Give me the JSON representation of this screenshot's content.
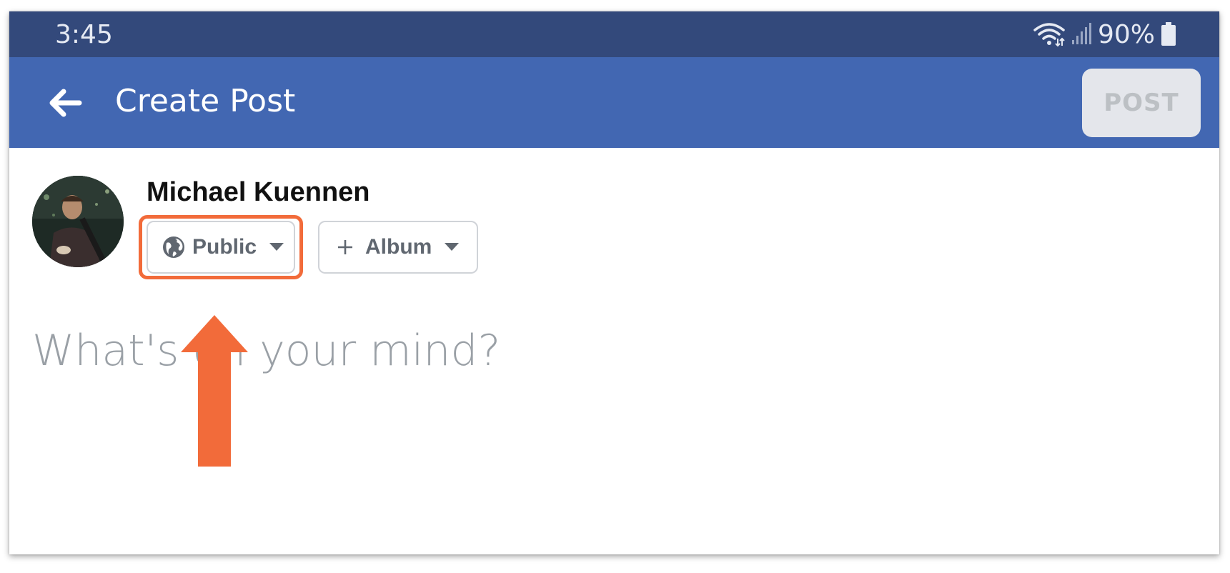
{
  "status_bar": {
    "time": "3:45",
    "battery": "90%",
    "icons": [
      "wifi-icon",
      "signal-icon",
      "battery-icon"
    ]
  },
  "app_bar": {
    "back_icon": "back-arrow-icon",
    "title": "Create Post",
    "post_label": "POST"
  },
  "composer": {
    "user_name": "Michael Kuennen",
    "privacy": {
      "icon": "globe-icon",
      "label": "Public",
      "caret_icon": "caret-down-icon"
    },
    "album": {
      "icon": "plus-icon",
      "label": "Album",
      "caret_icon": "caret-down-icon"
    },
    "placeholder": "What's on your mind?"
  },
  "annotation": {
    "highlight_color": "#f26b3a",
    "arrow_color": "#f26b3a"
  },
  "colors": {
    "status_bar": "#33497b",
    "app_bar": "#4267b2",
    "post_button_bg": "#e4e6eb",
    "post_button_text": "#bcc0c4"
  }
}
